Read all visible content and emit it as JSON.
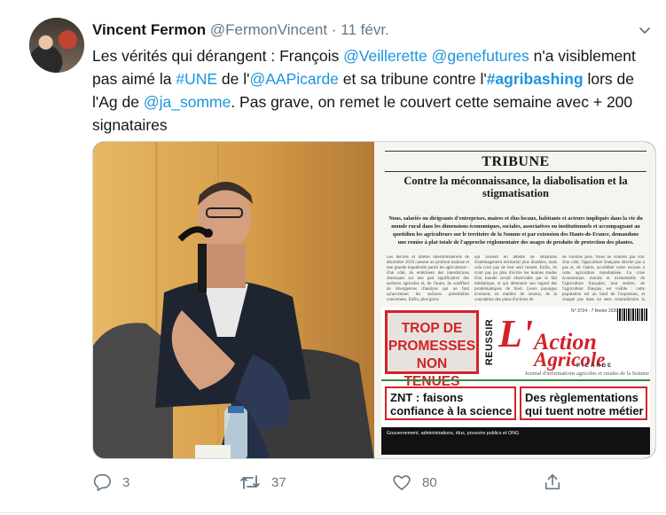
{
  "tweet": {
    "author_name": "Vincent Fermon",
    "author_handle": "@FermonVincent",
    "separator": "·",
    "date": "11 févr.",
    "text_parts": [
      {
        "text": "Les vérités qui dérangent : François ",
        "style": "plain"
      },
      {
        "text": "@Veillerette",
        "style": "link"
      },
      {
        "text": " ",
        "style": "plain"
      },
      {
        "text": "@genefutures",
        "style": "link"
      },
      {
        "text": " n'a visiblement pas aimé la ",
        "style": "plain"
      },
      {
        "text": "#UNE",
        "style": "link"
      },
      {
        "text": " de l'",
        "style": "plain"
      },
      {
        "text": "@AAPicarde",
        "style": "link"
      },
      {
        "text": " et sa tribune contre l'",
        "style": "plain"
      },
      {
        "text": "#agribashing",
        "style": "link-bold"
      },
      {
        "text": " lors de l'Ag de ",
        "style": "plain"
      },
      {
        "text": "@ja_somme",
        "style": "link"
      },
      {
        "text": ". Pas grave, on remet le couvert cette semaine avec + 200 signataires",
        "style": "plain"
      }
    ]
  },
  "media": {
    "newspaper": {
      "tribune_title": "TRIBUNE",
      "tribune_headline": "Contre la méconnaissance, la diabolisation et la stigmatisation",
      "tribune_intro": "Nous, salariés ou dirigeants d'entreprises, maires et élus locaux, habitants et acteurs impliqués dans la vie du monde rural dans les dimensions économiques, sociales, associatives ou institutionnels et accompagnant au quotidien les agriculteurs sur le territoire de la Somme et par extension des Hauts-de-France, demandons une remise à plat totale de l'approche réglementaire des usages de produits de protection des plantes.",
      "col1": "Les décrets et arrêtés interministériels de décembre 2019 causent un profond malaise et une grande inquiétude parmi les agriculteurs : d'un côté, ils entérinent des interdictions drastiques sur une part significative des surfaces agricoles et, de l'autre, ils soufflent de divergences d'analyse qui ne font qu'accentuer les surfaces potentielles concernées. Enfin, plus grave",
      "col2": "qui avaient en attente de situations d'aménagement territorial plus durables, mais cela n'est pas de leur seul ressort. Enfin, ils n'ont pas pu plus d'écrire les bonnes études d'un monde social observable par le fait médiatique, et qui démontre son regard des problématiques de fond. Leurs paysages évoluent, en matière de raisons, de la conception des plans d'actions de",
      "col3": "ne voulons plus. Nous ne voulons pas voir d'un côté, l'agriculture française décrite pas à pas et, de l'autre, accréditer notre recours à cette agriculture mondialisée. La crise économique, morale et existentielle de l'agriculture française, tout entière, de l'agriculteur français, est visible : cette population est au bord de l'explosion, et chaque pas dans un sens contradictoire la renforce d'un",
      "promo": "TROP DE PROMESSES NON TENUES",
      "reussir": "REUSSIR",
      "logo_line1": "L'",
      "logo_line2": "Action",
      "logo_line3": "Agricole",
      "picarde": "PICARDE",
      "issue": "N° 3724 - 7 février 2020",
      "journal_line": "Journal d'informations agricoles et rurales de la Somme",
      "headline_znt": "ZNT : faisons confiance à la science",
      "headline_regl": "Des règlementations qui tuent notre métier",
      "footer_bar": "Gouvernement, administrations, élus, pouvoirs publics et ONG"
    }
  },
  "actions": {
    "reply_count": "3",
    "retweet_count": "37",
    "like_count": "80"
  },
  "icons": [
    "chevron-down-icon",
    "reply-icon",
    "retweet-icon",
    "like-icon",
    "share-icon"
  ],
  "colors": {
    "link": "#1b95e0",
    "muted": "#657786",
    "newspaper_red": "#d2232a"
  }
}
